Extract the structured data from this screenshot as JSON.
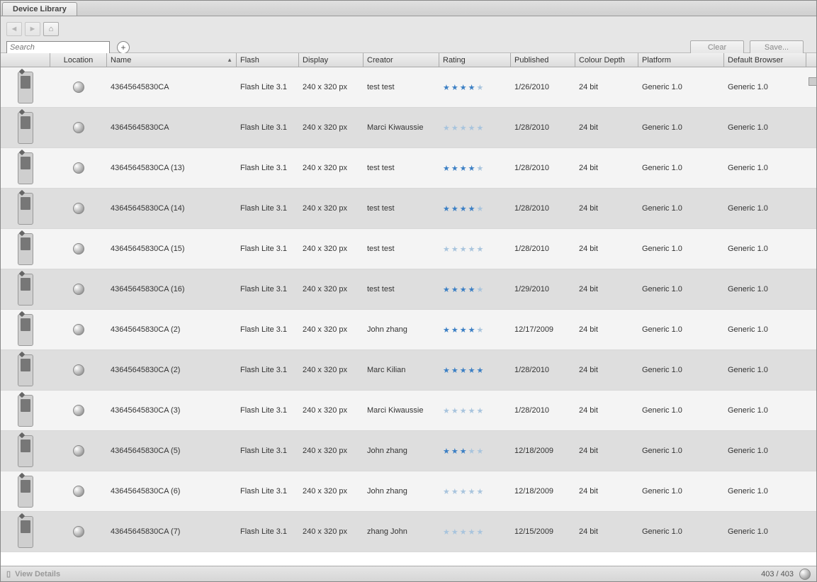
{
  "tab_title": "Device Library",
  "search_placeholder": "Search",
  "buttons": {
    "clear": "Clear",
    "save": "Save..."
  },
  "columns": {
    "location": "Location",
    "name": "Name",
    "flash": "Flash",
    "display": "Display",
    "creator": "Creator",
    "rating": "Rating",
    "published": "Published",
    "colour": "Colour Depth",
    "platform": "Platform",
    "browser": "Default Browser"
  },
  "rows": [
    {
      "name": "43645645830CA",
      "flash": "Flash Lite 3.1",
      "display": "240 x 320 px",
      "creator": "test test",
      "rating": 4,
      "published": "1/26/2010",
      "colour": "24 bit",
      "platform": "Generic 1.0",
      "browser": "Generic 1.0"
    },
    {
      "name": "43645645830CA",
      "flash": "Flash Lite 3.1",
      "display": "240 x 320 px",
      "creator": "Marci Kiwaussie",
      "rating": 0,
      "published": "1/28/2010",
      "colour": "24 bit",
      "platform": "Generic 1.0",
      "browser": "Generic 1.0"
    },
    {
      "name": "43645645830CA (13)",
      "flash": "Flash Lite 3.1",
      "display": "240 x 320 px",
      "creator": "test test",
      "rating": 4,
      "published": "1/28/2010",
      "colour": "24 bit",
      "platform": "Generic 1.0",
      "browser": "Generic 1.0"
    },
    {
      "name": "43645645830CA (14)",
      "flash": "Flash Lite 3.1",
      "display": "240 x 320 px",
      "creator": "test test",
      "rating": 4,
      "published": "1/28/2010",
      "colour": "24 bit",
      "platform": "Generic 1.0",
      "browser": "Generic 1.0"
    },
    {
      "name": "43645645830CA (15)",
      "flash": "Flash Lite 3.1",
      "display": "240 x 320 px",
      "creator": "test test",
      "rating": 0,
      "published": "1/28/2010",
      "colour": "24 bit",
      "platform": "Generic 1.0",
      "browser": "Generic 1.0"
    },
    {
      "name": "43645645830CA (16)",
      "flash": "Flash Lite 3.1",
      "display": "240 x 320 px",
      "creator": "test test",
      "rating": 4,
      "published": "1/29/2010",
      "colour": "24 bit",
      "platform": "Generic 1.0",
      "browser": "Generic 1.0"
    },
    {
      "name": "43645645830CA (2)",
      "flash": "Flash Lite 3.1",
      "display": "240 x 320 px",
      "creator": "John zhang",
      "rating": 4,
      "published": "12/17/2009",
      "colour": "24 bit",
      "platform": "Generic 1.0",
      "browser": "Generic 1.0"
    },
    {
      "name": "43645645830CA (2)",
      "flash": "Flash Lite 3.1",
      "display": "240 x 320 px",
      "creator": "Marc Kilian",
      "rating": 5,
      "published": "1/28/2010",
      "colour": "24 bit",
      "platform": "Generic 1.0",
      "browser": "Generic 1.0"
    },
    {
      "name": "43645645830CA (3)",
      "flash": "Flash Lite 3.1",
      "display": "240 x 320 px",
      "creator": "Marci Kiwaussie",
      "rating": 0,
      "published": "1/28/2010",
      "colour": "24 bit",
      "platform": "Generic 1.0",
      "browser": "Generic 1.0"
    },
    {
      "name": "43645645830CA (5)",
      "flash": "Flash Lite 3.1",
      "display": "240 x 320 px",
      "creator": "John zhang",
      "rating": 3,
      "published": "12/18/2009",
      "colour": "24 bit",
      "platform": "Generic 1.0",
      "browser": "Generic 1.0"
    },
    {
      "name": "43645645830CA (6)",
      "flash": "Flash Lite 3.1",
      "display": "240 x 320 px",
      "creator": "John zhang",
      "rating": 0,
      "published": "12/18/2009",
      "colour": "24 bit",
      "platform": "Generic 1.0",
      "browser": "Generic 1.0"
    },
    {
      "name": "43645645830CA (7)",
      "flash": "Flash Lite 3.1",
      "display": "240 x 320 px",
      "creator": "zhang John",
      "rating": 0,
      "published": "12/15/2009",
      "colour": "24 bit",
      "platform": "Generic 1.0",
      "browser": "Generic 1.0"
    }
  ],
  "status": {
    "view_details": "View Details",
    "counter": "403 / 403"
  }
}
